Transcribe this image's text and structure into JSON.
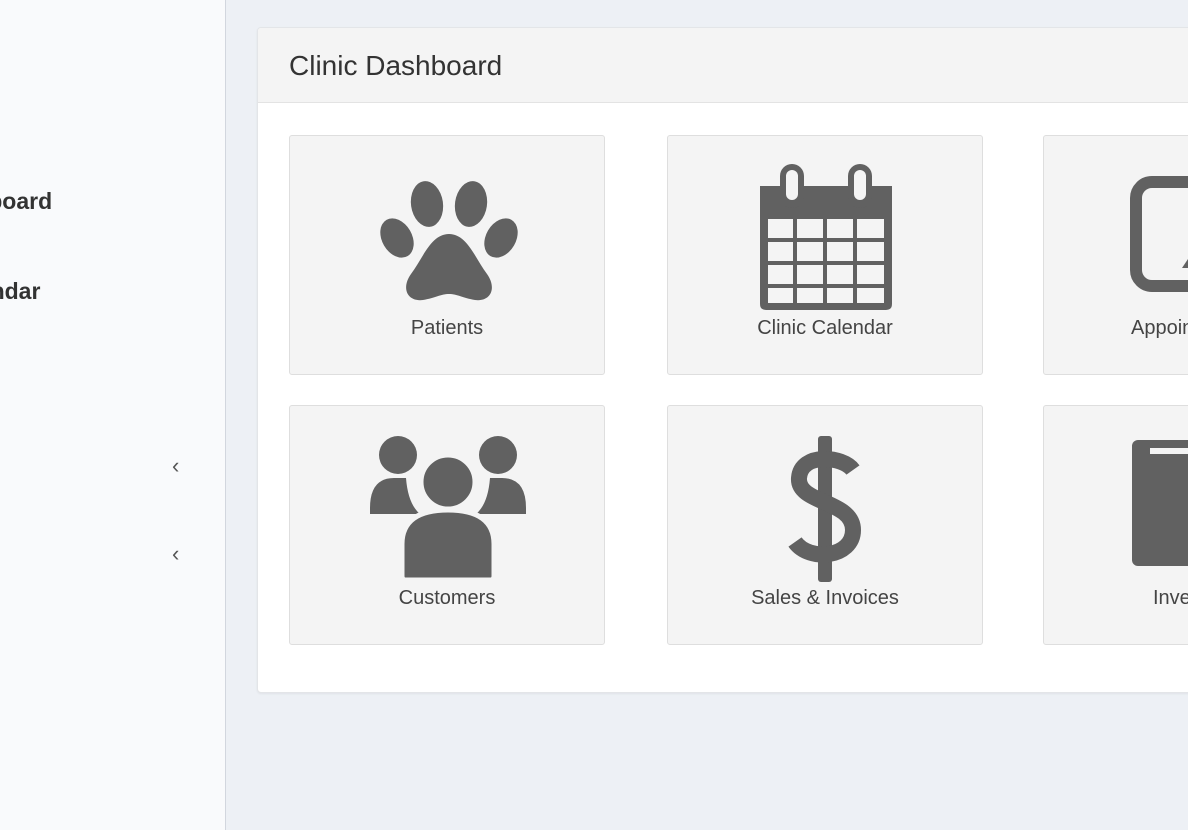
{
  "sidebar": {
    "items": [
      {
        "label": "Dashboard"
      },
      {
        "label": "Calendar"
      }
    ],
    "collapse_glyph": "‹"
  },
  "dashboard": {
    "title": "Clinic Dashboard",
    "tiles": [
      {
        "label": "Patients",
        "icon": "paw-icon"
      },
      {
        "label": "Clinic Calendar",
        "icon": "calendar-icon"
      },
      {
        "label": "Appointments",
        "icon": "appointment-icon"
      },
      {
        "label": "Customers",
        "icon": "users-icon"
      },
      {
        "label": "Sales & Invoices",
        "icon": "dollar-icon"
      },
      {
        "label": "Inventory",
        "icon": "book-icon"
      }
    ]
  },
  "colors": {
    "icon": "#616161",
    "background": "#edf0f5",
    "tile": "#f4f4f4"
  }
}
